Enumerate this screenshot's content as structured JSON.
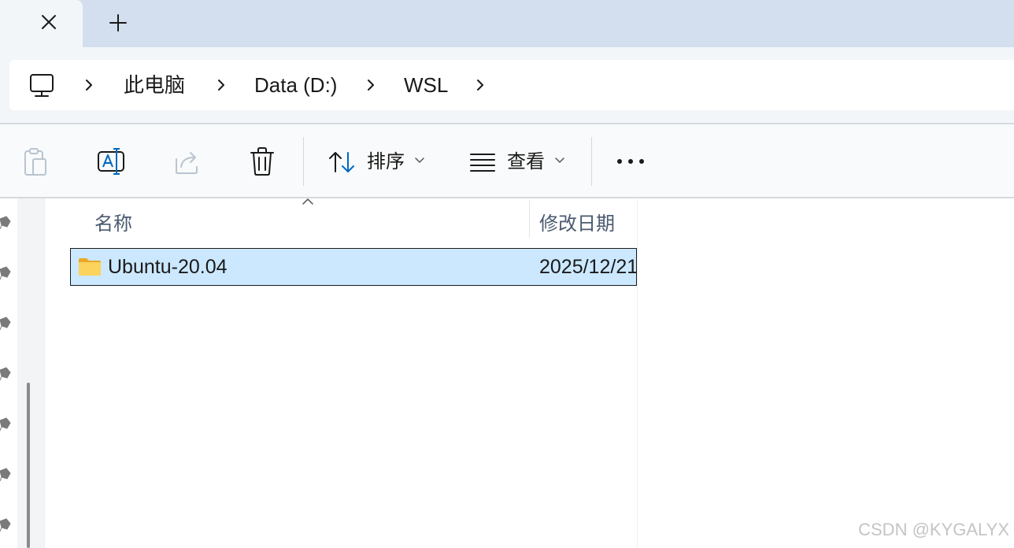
{
  "tabs": {
    "new_tab_symbol": "+"
  },
  "breadcrumb": {
    "items": [
      "此电脑",
      "Data (D:)",
      "WSL"
    ]
  },
  "toolbar": {
    "sort_label": "排序",
    "view_label": "查看"
  },
  "columns": {
    "name": "名称",
    "date_modified": "修改日期"
  },
  "files": [
    {
      "name": "Ubuntu-20.04",
      "date": "2025/12/21",
      "selected": true
    }
  ],
  "watermark": "CSDN @KYGALYX",
  "colors": {
    "accent": "#0067c0",
    "selection": "#cce8ff",
    "folder": "#f8c33a"
  }
}
